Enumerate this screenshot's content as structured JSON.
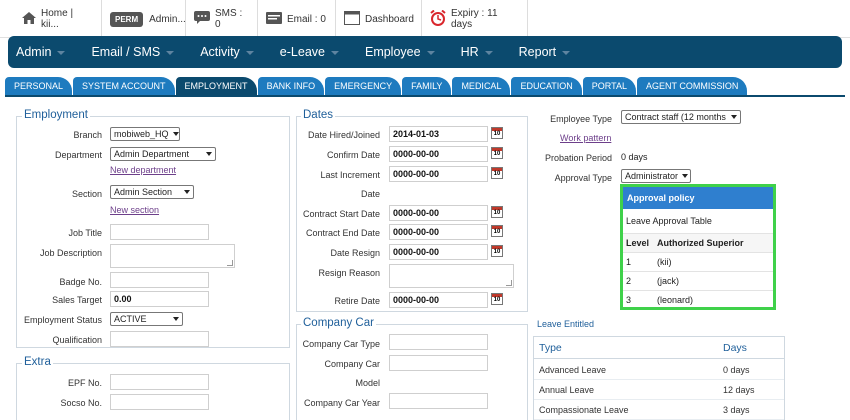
{
  "topbar": {
    "home": "Home | kii...",
    "perm_badge": "PERM",
    "admin": "Admin...",
    "sms": "SMS : 0",
    "email": "Email : 0",
    "dashboard": "Dashboard",
    "expiry": "Expiry : 11 days"
  },
  "mainnav": [
    "Admin",
    "Email / SMS",
    "Activity",
    "e-Leave",
    "Employee",
    "HR",
    "Report"
  ],
  "tabs": [
    "PERSONAL",
    "SYSTEM ACCOUNT",
    "EMPLOYMENT",
    "BANK INFO",
    "EMERGENCY",
    "FAMILY",
    "MEDICAL",
    "EDUCATION",
    "PORTAL",
    "AGENT COMMISSION"
  ],
  "active_tab": "EMPLOYMENT",
  "employment": {
    "title": "Employment",
    "branch_label": "Branch",
    "branch_value": "mobiweb_HQ",
    "department_label": "Department",
    "department_value": "Admin Department",
    "new_department": "New department",
    "section_label": "Section",
    "section_value": "Admin Section",
    "new_section": "New section",
    "job_title_label": "Job Title",
    "job_description_label": "Job Description",
    "badge_no_label": "Badge No.",
    "sales_target_label": "Sales Target",
    "sales_target_value": "0.00",
    "employment_status_label": "Employment Status",
    "employment_status_value": "ACTIVE",
    "qualification_label": "Qualification"
  },
  "extra": {
    "title": "Extra",
    "epf_label": "EPF No.",
    "socso_label": "Socso No."
  },
  "dates": {
    "title": "Dates",
    "date_hired_label": "Date Hired/Joined",
    "date_hired_value": "2014-01-03",
    "confirm_label": "Confirm Date",
    "confirm_value": "0000-00-00",
    "last_increment_label": "Last Increment",
    "last_increment_label2": "Date",
    "last_increment_value": "0000-00-00",
    "contract_start_label": "Contract Start Date",
    "contract_start_value": "0000-00-00",
    "contract_end_label": "Contract End Date",
    "contract_end_value": "0000-00-00",
    "date_resign_label": "Date Resign",
    "date_resign_value": "0000-00-00",
    "resign_reason_label": "Resign Reason",
    "retire_label": "Retire Date",
    "retire_value": "0000-00-00",
    "calendar_icon_text": "10"
  },
  "company_car": {
    "title": "Company Car",
    "type_label": "Company Car Type",
    "model_label": "Company Car",
    "model_label2": "Model",
    "year_label": "Company Car Year"
  },
  "right": {
    "employee_type_label": "Employee Type",
    "employee_type_value": "Contract staff (12 months",
    "work_pattern": "Work pattern",
    "probation_label": "Probation Period",
    "probation_value": "0 days",
    "approval_type_label": "Approval Type",
    "approval_type_value": "Administrator"
  },
  "approval_policy": {
    "title": "Approval policy",
    "subtitle": "Leave Approval Table",
    "col_level": "Level",
    "col_superior": "Authorized Superior",
    "rows": [
      {
        "level": "1",
        "superior": "(kii)"
      },
      {
        "level": "2",
        "superior": "(jack)"
      },
      {
        "level": "3",
        "superior": "(leonard)"
      }
    ],
    "border_color": "#3fd14a"
  },
  "leave_entitled": {
    "title": "Leave Entitled",
    "col_type": "Type",
    "col_days": "Days",
    "rows": [
      {
        "type": "Advanced Leave",
        "days": "0 days"
      },
      {
        "type": "Annual Leave",
        "days": "12 days"
      },
      {
        "type": "Compassionate Leave",
        "days": "3 days"
      }
    ]
  },
  "colors": {
    "nav_bg": "#0b4a6e",
    "tab_bg": "#1e7bbf",
    "section_title": "#1f5f9a",
    "approval_head": "#2f7fcf"
  }
}
